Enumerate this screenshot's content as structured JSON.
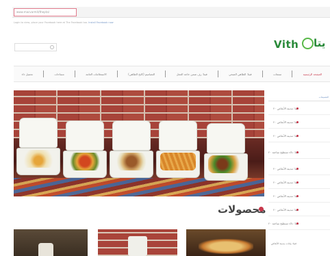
{
  "browser": {
    "url": "www.macvarmit/thepta/"
  },
  "notice": {
    "text": "Login to view, place your Facebook here at The Facebook too.",
    "link": "Install Facebook now"
  },
  "search": {
    "placeholder": ""
  },
  "logo": {
    "latin": "Vith",
    "arabic": "يتا"
  },
  "nav": [
    {
      "label": "الصفحه الرئيسيه",
      "active": true
    },
    {
      "label": "منتجات",
      "active": false
    },
    {
      "label": "فيتا: الطاهي الصحي",
      "active": false
    },
    {
      "label": "فيتا: رف ضمن حاجة العجل",
      "active": false
    },
    {
      "label": "التصاميم (كابح الطاهي)",
      "active": false
    },
    {
      "label": "الاستعلامات العامة",
      "active": false
    },
    {
      "label": "مساحات",
      "active": false
    },
    {
      "label": "تحميل داء",
      "active": false
    }
  ],
  "hero": {
    "alt": ""
  },
  "section": {
    "title": "محصولات"
  },
  "sidebar": {
    "header": "التصنيفات",
    "items": [
      "فيتا: مدينة الأنخاص ٢٠",
      "فيتا: مدينة الأنخاص ٢٠",
      "فيتا: مدينة الأنخاص ٢٠",
      "فيتا: دلاء تسطيح ساخنة ٢٠",
      "فيتا: مدينة الأنخاص ٢٠",
      "فيتا: مدينة الأنخاص ٢٠",
      "فيتا: مدينة الأنخاص ٢٠",
      "فيتا: مدينة الأنخاص ٢٠",
      "فيتا: دلاء تسطيح ساخنة ٢٠"
    ],
    "bottom": "فيتا: بيانات مدينة الأنخاص"
  },
  "colors": {
    "accent": "#c8384b",
    "brand": "#2a8a3a",
    "link": "#7a9ac8"
  }
}
